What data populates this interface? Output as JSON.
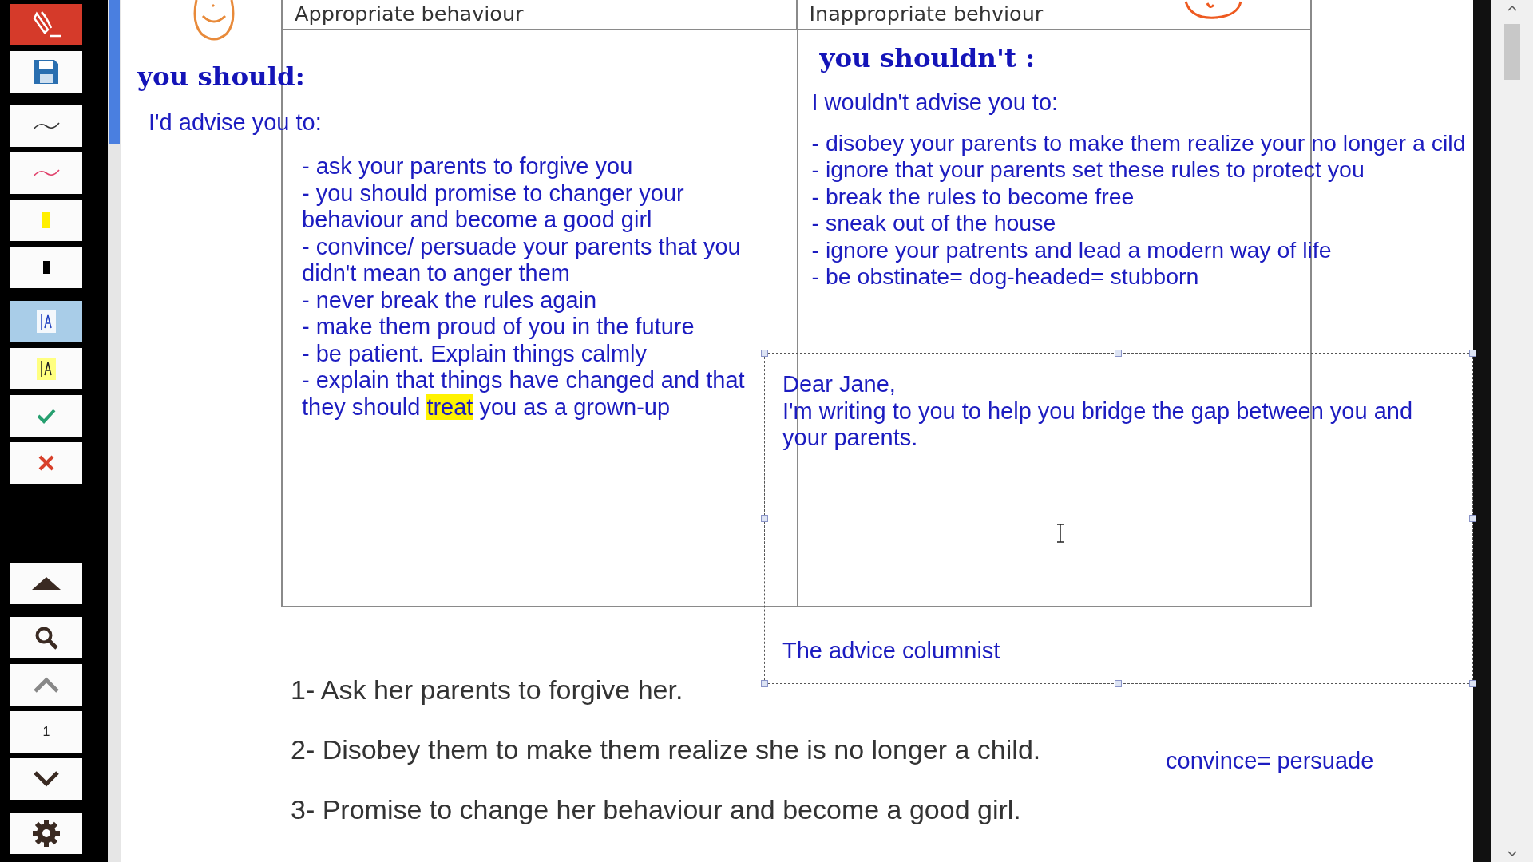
{
  "toolbar": {
    "tools": [
      {
        "kind": "logo",
        "selected": false
      },
      {
        "kind": "save",
        "selected": false
      },
      {
        "kind": "pen-black",
        "selected": false
      },
      {
        "kind": "pen-red",
        "selected": false
      },
      {
        "kind": "marker-yellow",
        "selected": false
      },
      {
        "kind": "marker-black",
        "selected": false
      },
      {
        "kind": "text-blue",
        "selected": true
      },
      {
        "kind": "text-yellow",
        "selected": false
      },
      {
        "kind": "check",
        "selected": false
      },
      {
        "kind": "cross",
        "selected": false
      }
    ],
    "nav": [
      {
        "kind": "first"
      },
      {
        "kind": "search"
      },
      {
        "kind": "prev"
      },
      {
        "kind": "page",
        "label": "1"
      },
      {
        "kind": "next"
      },
      {
        "kind": "settings"
      }
    ]
  },
  "document": {
    "table": {
      "columns": [
        "Appropriate behaviour",
        "Inappropriate behviour"
      ]
    },
    "left": {
      "heading": "you should:",
      "intro": "I'd advise you to:",
      "items": [
        {
          "lines": [
            "- ask your parents to forgive you"
          ]
        },
        {
          "lines": [
            "- you should promise to changer your",
            "behaviour and become a good girl"
          ]
        },
        {
          "lines": [
            "- convince/ persuade your parents that you",
            "didn't mean to anger them"
          ]
        },
        {
          "lines": [
            "- never break the rules again"
          ]
        },
        {
          "lines": [
            "- make them proud of you in the future"
          ]
        },
        {
          "lines": [
            "- be patient. Explain things calmly"
          ]
        },
        {
          "lines": [
            "- explain that things have changed and that",
            {
              "parts": [
                {
                  "text": "they should ",
                  "highlighted": false
                },
                {
                  "text": "treat",
                  "highlighted": true
                },
                {
                  "text": " you as a grown-up",
                  "highlighted": false
                }
              ]
            }
          ]
        }
      ]
    },
    "right": {
      "heading": "you shouldn't :",
      "intro": "I wouldn't advise you to:",
      "items": [
        "- disobey your parents to make them realize your no longer a cild",
        "-  ignore that your parents set these rules to protect you",
        "- break the rules to become free",
        "- sneak out of the house",
        "- ignore your patrents and lead a modern way of life",
        "- be obstinate= dog-headed= stubborn"
      ]
    },
    "letter": {
      "greeting": "Dear Jane,",
      "body": [
        " I'm writing to you to help you bridge the gap between you and",
        "your parents."
      ],
      "signature": "The advice columnist"
    },
    "answers": [
      "1- Ask her parents to forgive her.",
      "2- Disobey them  to make them realize she is no longer a child.",
      "3- Promise to change her behaviour and become a good girl."
    ],
    "note": "convince= persuade"
  }
}
